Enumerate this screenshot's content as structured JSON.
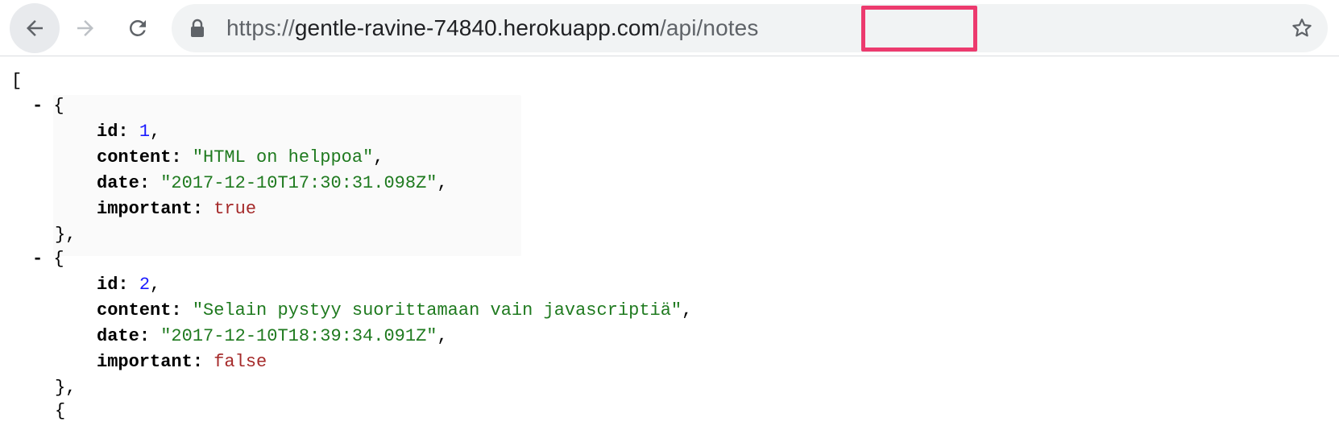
{
  "browser": {
    "url": {
      "scheme": "https://",
      "host": "gentle-ravine-74840.herokuapp.com",
      "path": "/api/notes"
    },
    "icons": {
      "back": "back-arrow-icon",
      "forward": "forward-arrow-icon",
      "reload": "reload-icon",
      "lock": "lock-icon",
      "bookmark": "star-icon"
    },
    "highlight_color": "#ec3a6e"
  },
  "json_view": {
    "open_bracket": "[",
    "collapser": "-",
    "items": [
      {
        "id": "1",
        "content": "\"HTML on helppoa\"",
        "date": "\"2017-12-10T17:30:31.098Z\"",
        "important": "true"
      },
      {
        "id": "2",
        "content": "\"Selain pystyy suorittamaan vain javascriptiä\"",
        "date": "\"2017-12-10T18:39:34.091Z\"",
        "important": "false"
      }
    ],
    "keys": {
      "id": "id",
      "content": "content",
      "date": "date",
      "important": "important"
    },
    "object_open": "{",
    "object_close": "},"
  },
  "colors": {
    "key": "#000000",
    "number": "#1a1aff",
    "string": "#1f7a1f",
    "boolean": "#a52a2a"
  }
}
